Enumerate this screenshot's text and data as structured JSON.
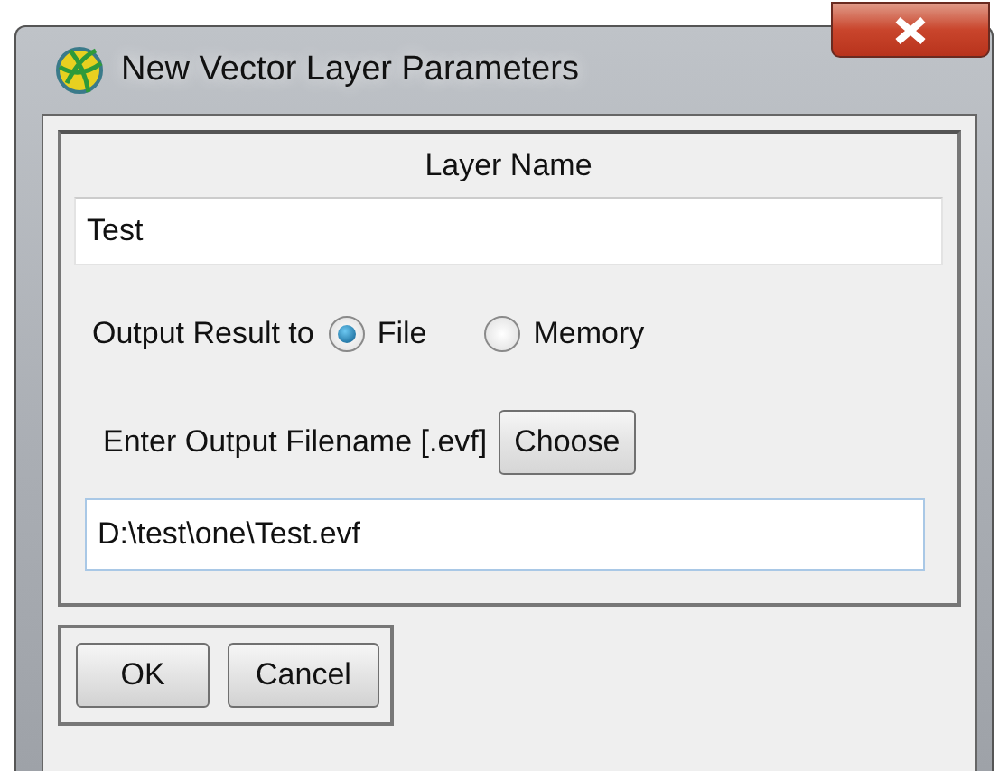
{
  "window": {
    "title": "New Vector Layer Parameters"
  },
  "layer_name": {
    "label": "Layer Name",
    "value": "Test"
  },
  "output": {
    "label": "Output Result to",
    "options": [
      {
        "label": "File",
        "selected": true
      },
      {
        "label": "Memory",
        "selected": false
      }
    ]
  },
  "filename": {
    "label": "Enter Output Filename [.evf]",
    "button": "Choose",
    "value": "D:\\test\\one\\Test.evf"
  },
  "buttons": [
    "OK",
    "Cancel"
  ]
}
